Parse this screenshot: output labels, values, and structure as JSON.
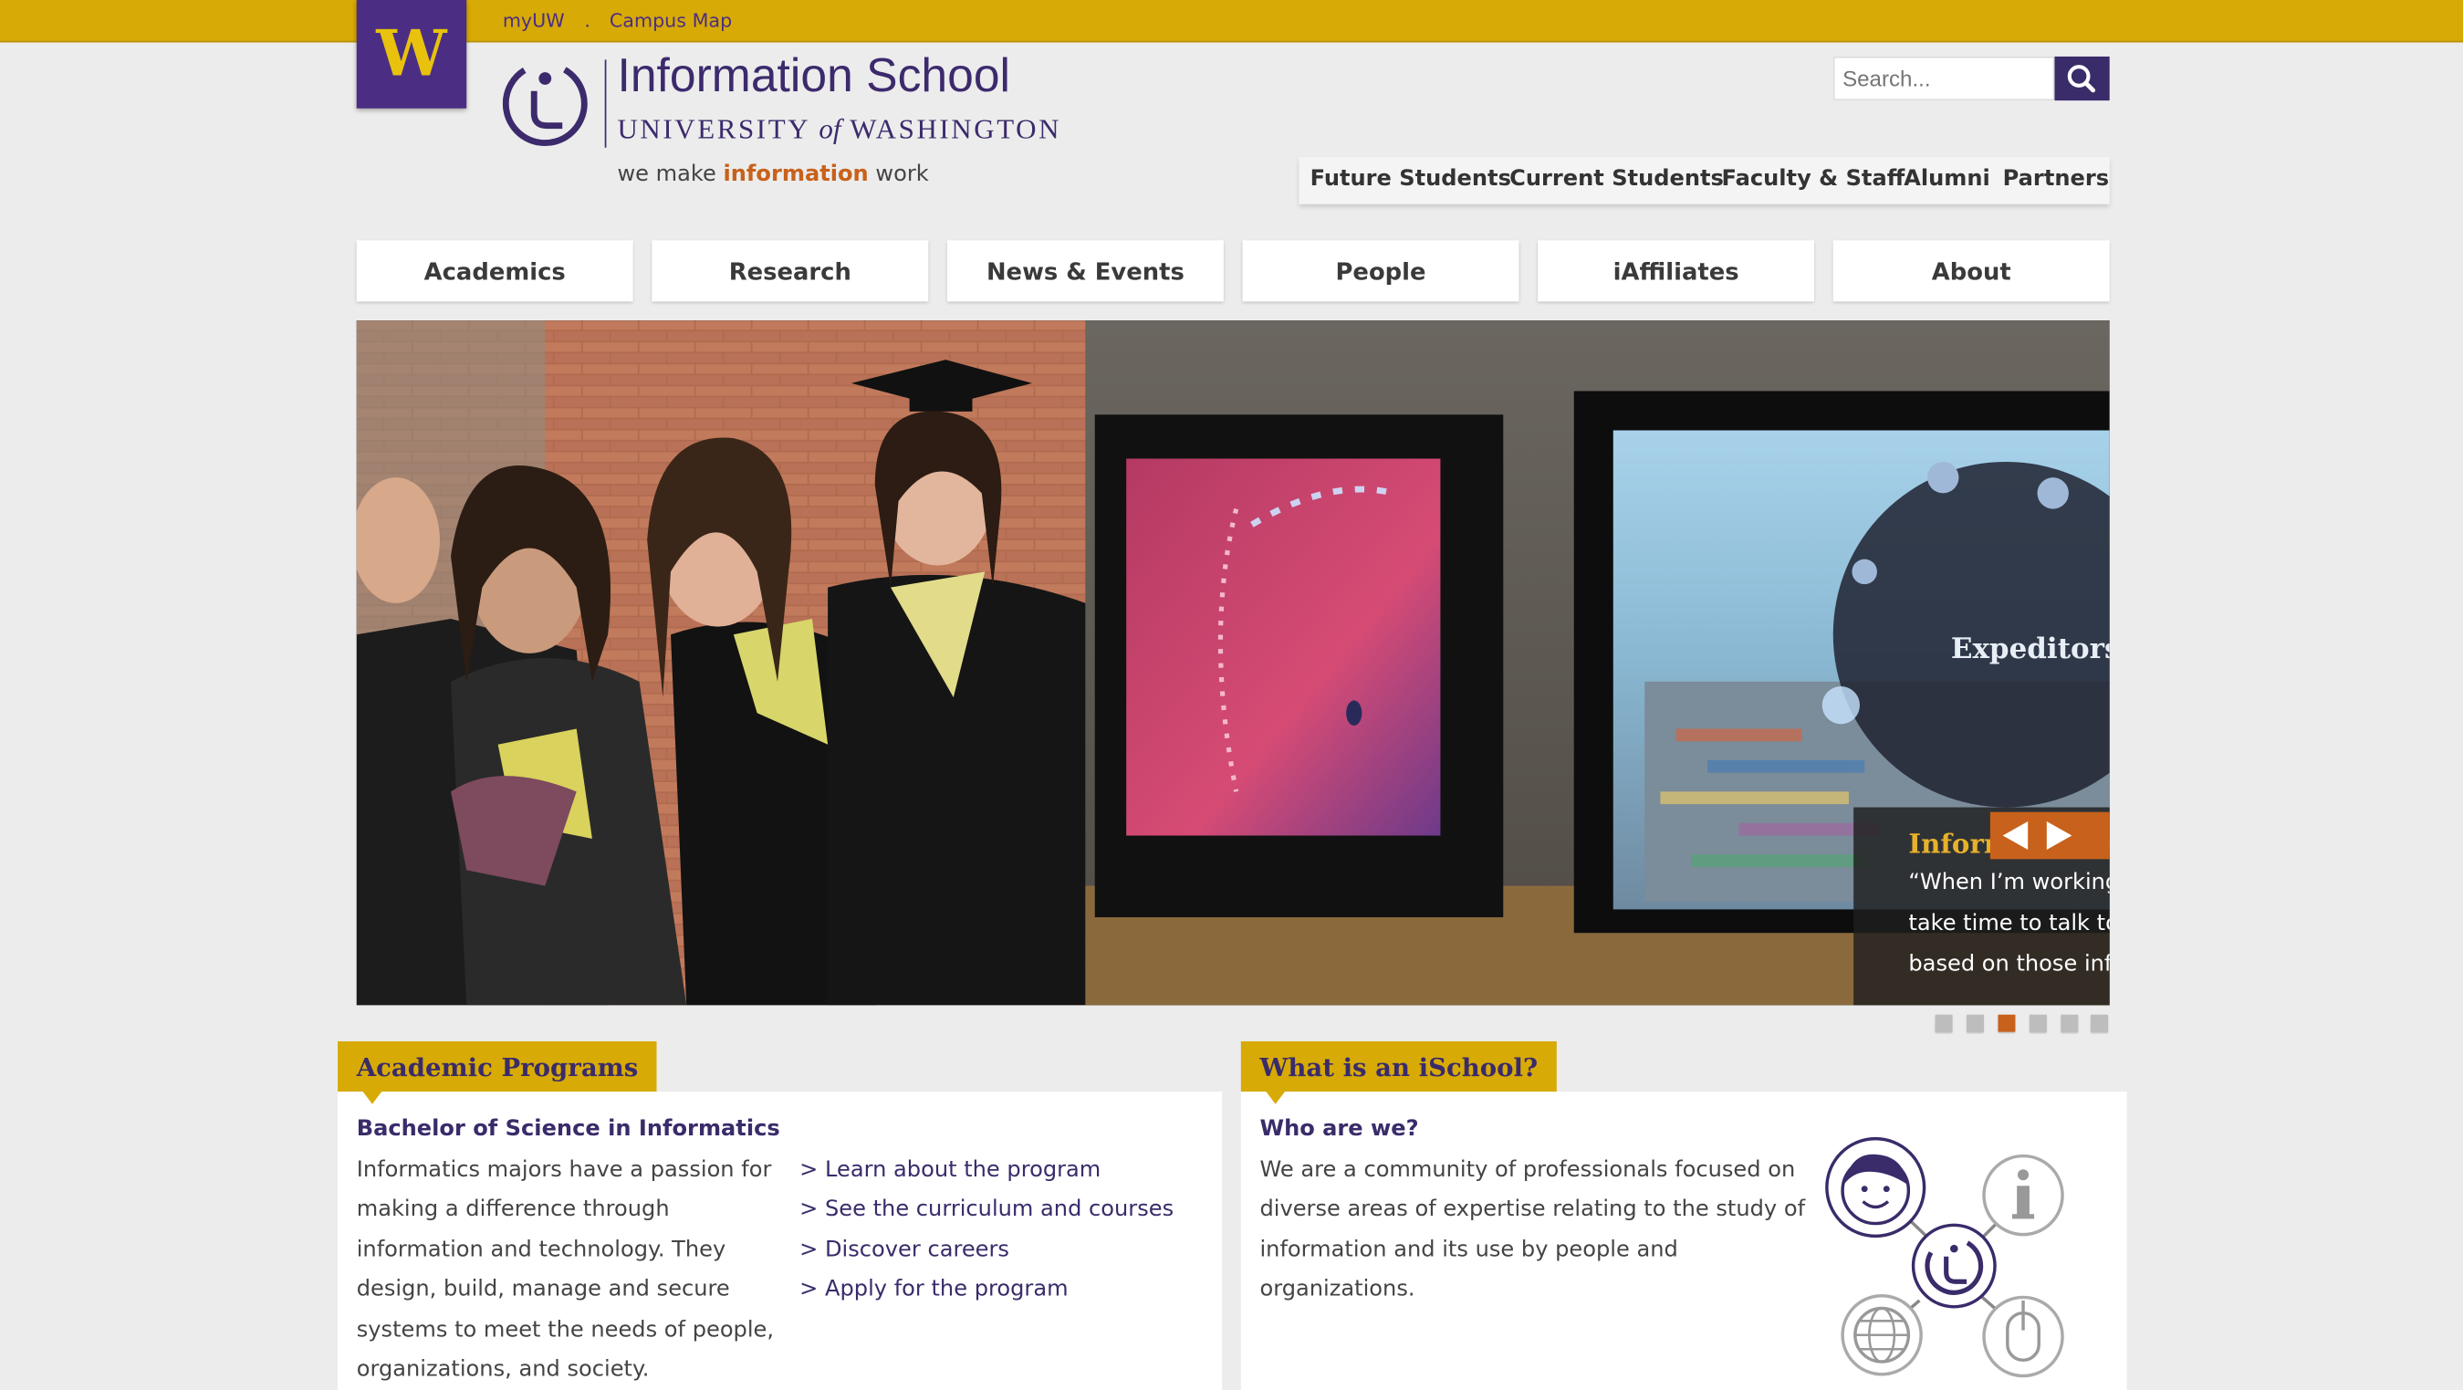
{
  "topbar": {
    "links": [
      "myUW",
      ".",
      "Campus Map"
    ]
  },
  "uw_logo": {
    "letter": "W"
  },
  "brand": {
    "title": "Information School",
    "subtitle_a": "UNIVERSITY",
    "subtitle_of": "of",
    "subtitle_b": "WASHINGTON",
    "tagline_a": "we make ",
    "tagline_hl": "information",
    "tagline_b": " work"
  },
  "search": {
    "placeholder": "Search..."
  },
  "audience_nav": [
    "Future Students",
    "Current Students",
    "Faculty & Staff",
    "Alumni",
    "Partners"
  ],
  "main_nav": [
    "Academics",
    "Research",
    "News & Events",
    "People",
    "iAffiliates",
    "About"
  ],
  "slider": {
    "caption_title": "Information M",
    "caption_lines": [
      "“When I’m working",
      "take time to talk to",
      "based on those inf"
    ],
    "slide_count": 6,
    "active_index": 2
  },
  "academic_programs": {
    "tab": "Academic Programs",
    "heading": "Bachelor of Science in Informatics",
    "body_lines": [
      "Informatics majors have a passion for",
      "making a difference through",
      "information and technology. They",
      "design, build, manage and secure",
      "systems to meet the needs of people,",
      "organizations, and society."
    ],
    "links": [
      "> Learn about the program",
      "> See the curriculum and courses",
      "> Discover careers",
      "> Apply for the program"
    ]
  },
  "what_is_ischool": {
    "tab": "What is an iSchool?",
    "heading": "Who are we?",
    "body_lines": [
      "We are a community of professionals focused on",
      "diverse areas of expertise relating to the study of",
      "information and its use by people and",
      "organizations."
    ]
  },
  "colors": {
    "gold": "#d7aa06",
    "purple": "#4b2e83",
    "orange": "#c8611b"
  }
}
